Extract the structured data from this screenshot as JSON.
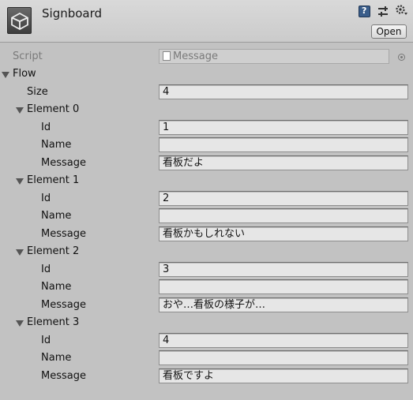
{
  "header": {
    "title": "Signboard",
    "open_label": "Open",
    "help_icon_label": "?"
  },
  "script": {
    "label": "Script",
    "value": "Message"
  },
  "flow": {
    "label": "Flow",
    "size_label": "Size",
    "size_value": "4",
    "elements": [
      {
        "label": "Element 0",
        "id_label": "Id",
        "id": "1",
        "name_label": "Name",
        "name": "",
        "message_label": "Message",
        "message": "看板だよ"
      },
      {
        "label": "Element 1",
        "id_label": "Id",
        "id": "2",
        "name_label": "Name",
        "name": "",
        "message_label": "Message",
        "message": "看板かもしれない"
      },
      {
        "label": "Element 2",
        "id_label": "Id",
        "id": "3",
        "name_label": "Name",
        "name": "",
        "message_label": "Message",
        "message": "おや…看板の様子が…"
      },
      {
        "label": "Element 3",
        "id_label": "Id",
        "id": "4",
        "name_label": "Name",
        "name": "",
        "message_label": "Message",
        "message": "看板ですよ"
      }
    ]
  }
}
